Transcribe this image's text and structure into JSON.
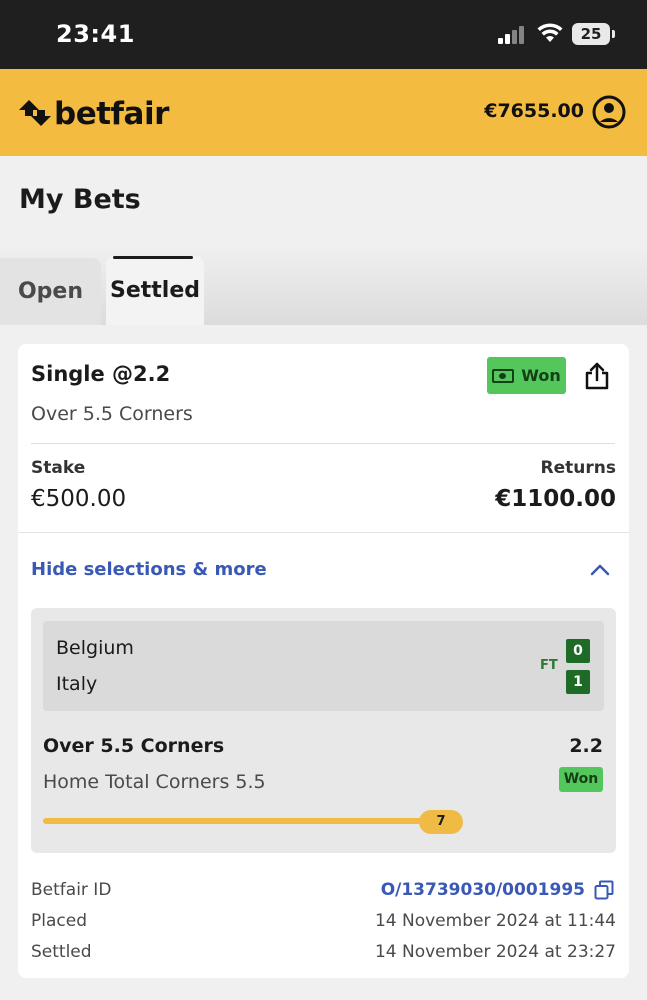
{
  "status_bar": {
    "time": "23:41",
    "battery": "25",
    "icons": [
      "signal-icon",
      "wifi-icon",
      "battery-icon"
    ]
  },
  "header": {
    "brand": "betfair",
    "balance": "€7655.00",
    "brand_color": "#f3bb3f",
    "icons": [
      "betfair-logo-icon",
      "account-icon"
    ]
  },
  "page": {
    "title": "My Bets"
  },
  "tabs": [
    {
      "label": "Open",
      "active": false
    },
    {
      "label": "Settled",
      "active": true
    }
  ],
  "bet": {
    "title": "Single @2.2",
    "status": "Won",
    "market": "Over 5.5 Corners",
    "stake_label": "Stake",
    "stake": "€500.00",
    "returns_label": "Returns",
    "returns": "€1100.00",
    "toggle_label": "Hide selections & more",
    "status_color": "#53c65c",
    "link_color": "#3a58b5"
  },
  "selection": {
    "home_team": "Belgium",
    "away_team": "Italy",
    "period": "FT",
    "home_score": "0",
    "away_score": "1",
    "market": "Over 5.5 Corners",
    "odds": "2.2",
    "description": "Home Total Corners 5.5",
    "result": "Won",
    "progress_value": "7",
    "progress_fraction": 1.0
  },
  "details": {
    "id_label": "Betfair ID",
    "id_value": "O/13739030/0001995",
    "placed_label": "Placed",
    "placed_value": "14 November 2024 at 11:44",
    "settled_label": "Settled",
    "settled_value": "14 November 2024 at 23:27"
  }
}
